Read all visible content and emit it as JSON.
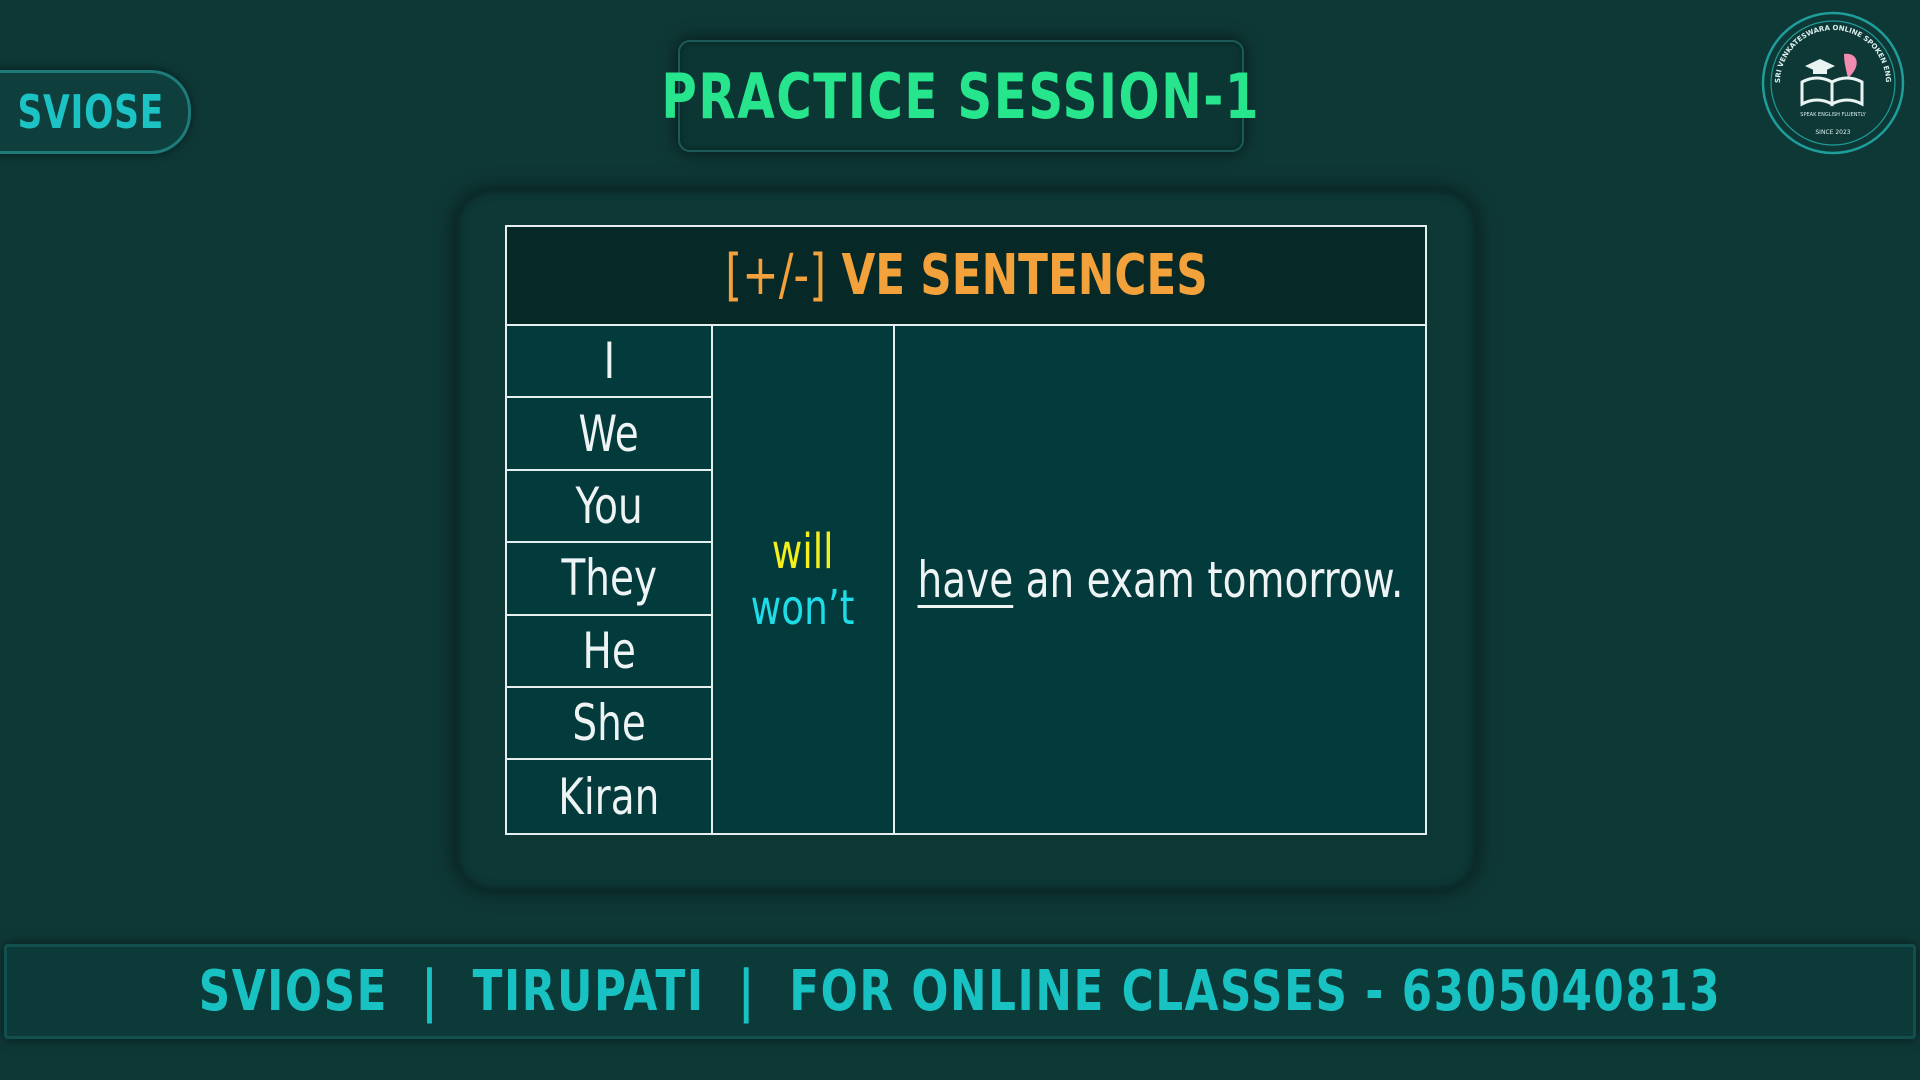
{
  "brand_tag": "SVIOSE",
  "title": "PRACTICE SESSION-1",
  "logo": {
    "ring_text": "SRI VENKATESWARA ONLINE SPOKEN ENGLISH SCHOOL",
    "tagline": "SPEAK ENGLISH FLUENTLY",
    "since": "SINCE 2023",
    "icon": "book-graduation-cap-icon"
  },
  "table": {
    "header_symbol": "[+/-]",
    "header_text": "VE SENTENCES",
    "subjects": [
      "I",
      "We",
      "You",
      "They",
      "He",
      "She",
      "Kiran"
    ],
    "aux_positive": "will",
    "aux_negative": "won’t",
    "verb": "have",
    "rest": "an exam tomorrow."
  },
  "footer": "SVIOSE  |  TIRUPATI  |  FOR ONLINE CLASSES - 6305040813",
  "colors": {
    "background": "#0e3836",
    "title_green": "#26e58d",
    "header_orange": "#f3a13a",
    "will_yellow": "#f5ef1c",
    "wont_cyan": "#1fdde8",
    "brand_teal": "#19c2c2"
  }
}
